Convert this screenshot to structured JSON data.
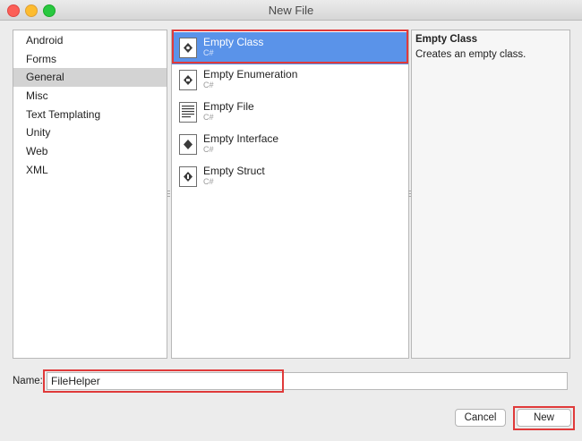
{
  "window": {
    "title": "New File"
  },
  "categories": [
    {
      "label": "Android"
    },
    {
      "label": "Forms"
    },
    {
      "label": "General",
      "selected": true
    },
    {
      "label": "Misc"
    },
    {
      "label": "Text Templating"
    },
    {
      "label": "Unity"
    },
    {
      "label": "Web"
    },
    {
      "label": "XML"
    }
  ],
  "templates": [
    {
      "name": "Empty Class",
      "sub": "C#",
      "icon": "class-icon",
      "selected": true
    },
    {
      "name": "Empty Enumeration",
      "sub": "C#",
      "icon": "enumeration-icon"
    },
    {
      "name": "Empty File",
      "sub": "C#",
      "icon": "file-icon"
    },
    {
      "name": "Empty Interface",
      "sub": "C#",
      "icon": "interface-icon"
    },
    {
      "name": "Empty Struct",
      "sub": "C#",
      "icon": "struct-icon"
    }
  ],
  "description": {
    "title": "Empty Class",
    "text": "Creates an empty class."
  },
  "name_field": {
    "label": "Name:",
    "value": "FileHelper"
  },
  "buttons": {
    "cancel": "Cancel",
    "new": "New"
  },
  "colors": {
    "selection": "#5a93e9",
    "category_selection": "#d3d3d3",
    "highlight": "#e03a3a"
  }
}
